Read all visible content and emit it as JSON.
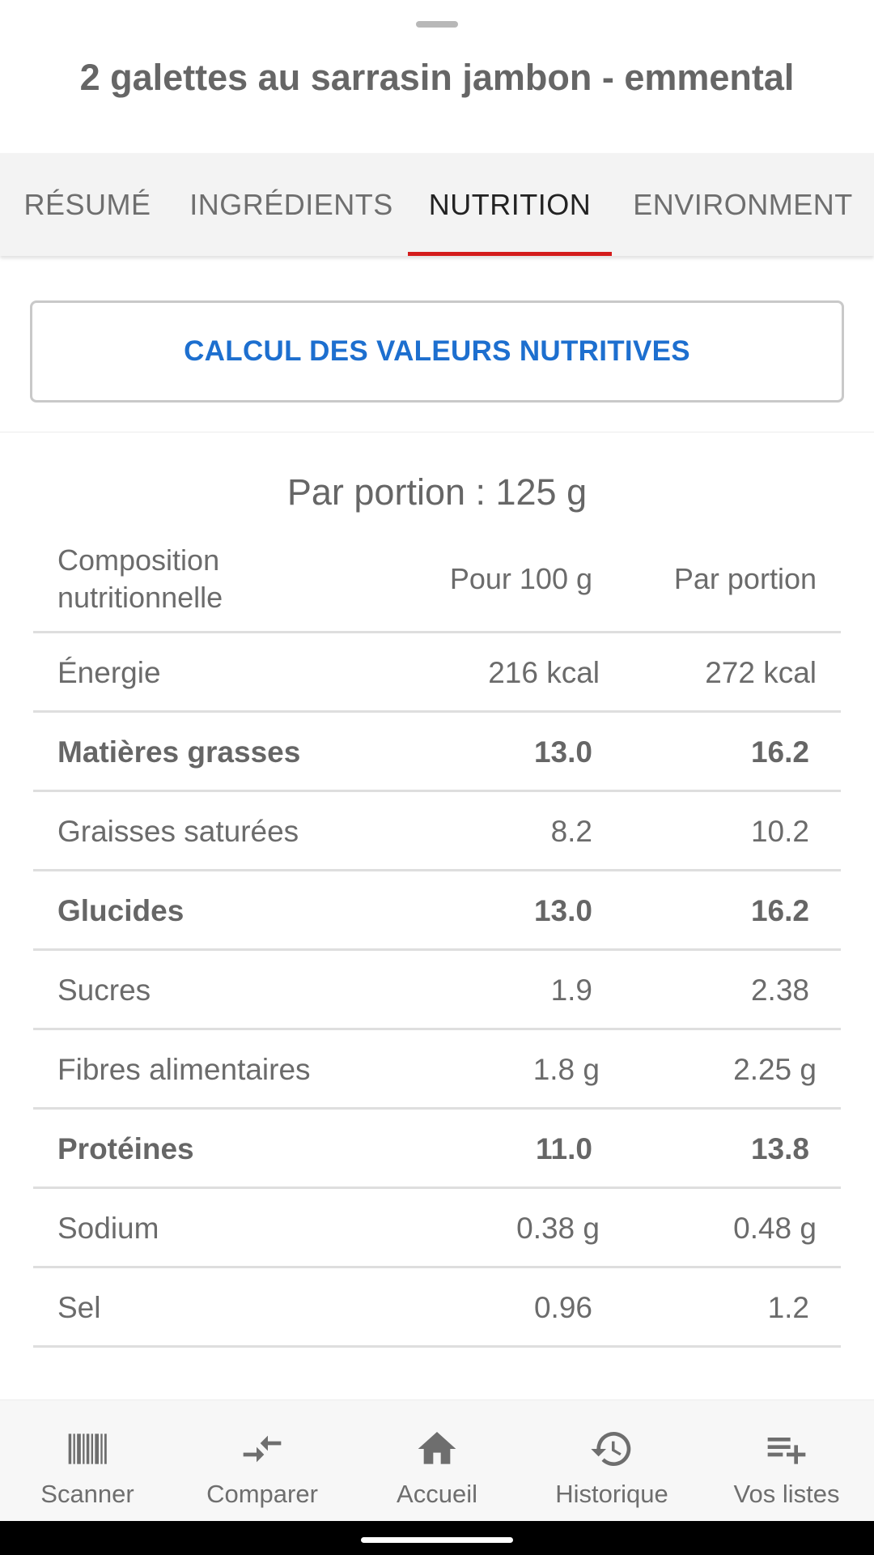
{
  "header": {
    "title": "2 galettes au sarrasin jambon - emmental"
  },
  "tabs": [
    {
      "label": "RÉSUMÉ",
      "active": false
    },
    {
      "label": "INGRÉDIENTS",
      "active": false
    },
    {
      "label": "NUTRITION",
      "active": true
    },
    {
      "label": "ENVIRONMENT",
      "active": false
    }
  ],
  "calc_button": {
    "label": "CALCUL DES VALEURS NUTRITIVES"
  },
  "nutrition": {
    "portion_title": "Par portion : 125 g",
    "headers": {
      "name": "Composition nutritionnelle",
      "per100": "Pour 100 g",
      "perPortion": "Par portion"
    },
    "rows": [
      {
        "name": "Énergie",
        "per100": "216 kcal",
        "perPortion": "272 kcal",
        "bold": false
      },
      {
        "name": "Matières grasses",
        "per100": "13.0",
        "perPortion": "16.2",
        "bold": true
      },
      {
        "name": "Graisses saturées",
        "per100": "8.2",
        "perPortion": "10.2",
        "bold": false
      },
      {
        "name": "Glucides",
        "per100": "13.0",
        "perPortion": "16.2",
        "bold": true
      },
      {
        "name": "Sucres",
        "per100": "1.9",
        "perPortion": "2.38",
        "bold": false
      },
      {
        "name": "Fibres alimentaires",
        "per100": "1.8 g",
        "perPortion": "2.25 g",
        "bold": false
      },
      {
        "name": "Protéines",
        "per100": "11.0",
        "perPortion": "13.8",
        "bold": true
      },
      {
        "name": "Sodium",
        "per100": "0.38 g",
        "perPortion": "0.48 g",
        "bold": false
      },
      {
        "name": "Sel",
        "per100": "0.96",
        "perPortion": "1.2",
        "bold": false
      }
    ]
  },
  "bottom_nav": [
    {
      "label": "Scanner",
      "icon": "barcode-icon"
    },
    {
      "label": "Comparer",
      "icon": "compare-icon"
    },
    {
      "label": "Accueil",
      "icon": "home-icon"
    },
    {
      "label": "Historique",
      "icon": "history-icon"
    },
    {
      "label": "Vos listes",
      "icon": "playlist-add-icon"
    }
  ],
  "colors": {
    "accent": "#d41c1c",
    "link": "#1d6fcf"
  }
}
